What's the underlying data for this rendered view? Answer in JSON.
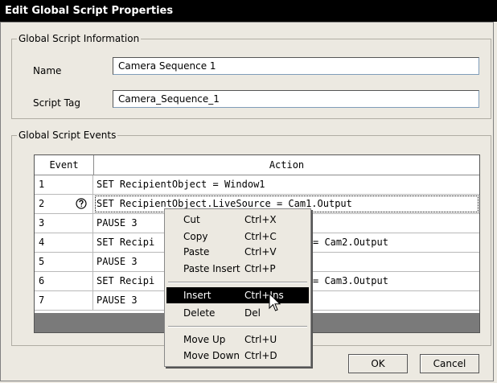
{
  "dialog": {
    "title": "Edit Global Script Properties"
  },
  "info_group": {
    "legend": "Global Script Information",
    "name_label": "Name",
    "name_value": "Camera Sequence 1",
    "tag_label": "Script Tag",
    "tag_value": "Camera_Sequence_1"
  },
  "events_group": {
    "legend": "Global Script Events",
    "columns": {
      "event": "Event",
      "action": "Action"
    },
    "rows": [
      {
        "event": "1",
        "action": "SET RecipientObject = Window1"
      },
      {
        "event": "2",
        "action": "SET RecipientObject.LiveSource = Cam1.Output"
      },
      {
        "event": "3",
        "action": "PAUSE 3"
      },
      {
        "event": "4",
        "action": "SET Recipi",
        "action_tail": "= Cam2.Output"
      },
      {
        "event": "5",
        "action": "PAUSE 3"
      },
      {
        "event": "6",
        "action": "SET Recipi",
        "action_tail": "= Cam3.Output"
      },
      {
        "event": "7",
        "action": "PAUSE 3"
      }
    ]
  },
  "buttons": {
    "ok": "OK",
    "cancel": "Cancel"
  },
  "context_menu": {
    "items": [
      {
        "label": "Cut",
        "shortcut": "Ctrl+X"
      },
      {
        "label": "Copy",
        "shortcut": "Ctrl+C"
      },
      {
        "label": "Paste",
        "shortcut": "Ctrl+V"
      },
      {
        "label": "Paste Insert",
        "shortcut": "Ctrl+P"
      },
      {
        "label": "Insert",
        "shortcut": "Ctrl+Ins"
      },
      {
        "label": "Delete",
        "shortcut": "Del"
      },
      {
        "label": "Move Up",
        "shortcut": "Ctrl+U"
      },
      {
        "label": "Move Down",
        "shortcut": "Ctrl+D"
      }
    ],
    "highlighted_index": 4
  },
  "icons": {
    "row2_icon": "help-question-icon",
    "cursor": "arrow-pointer-icon"
  }
}
